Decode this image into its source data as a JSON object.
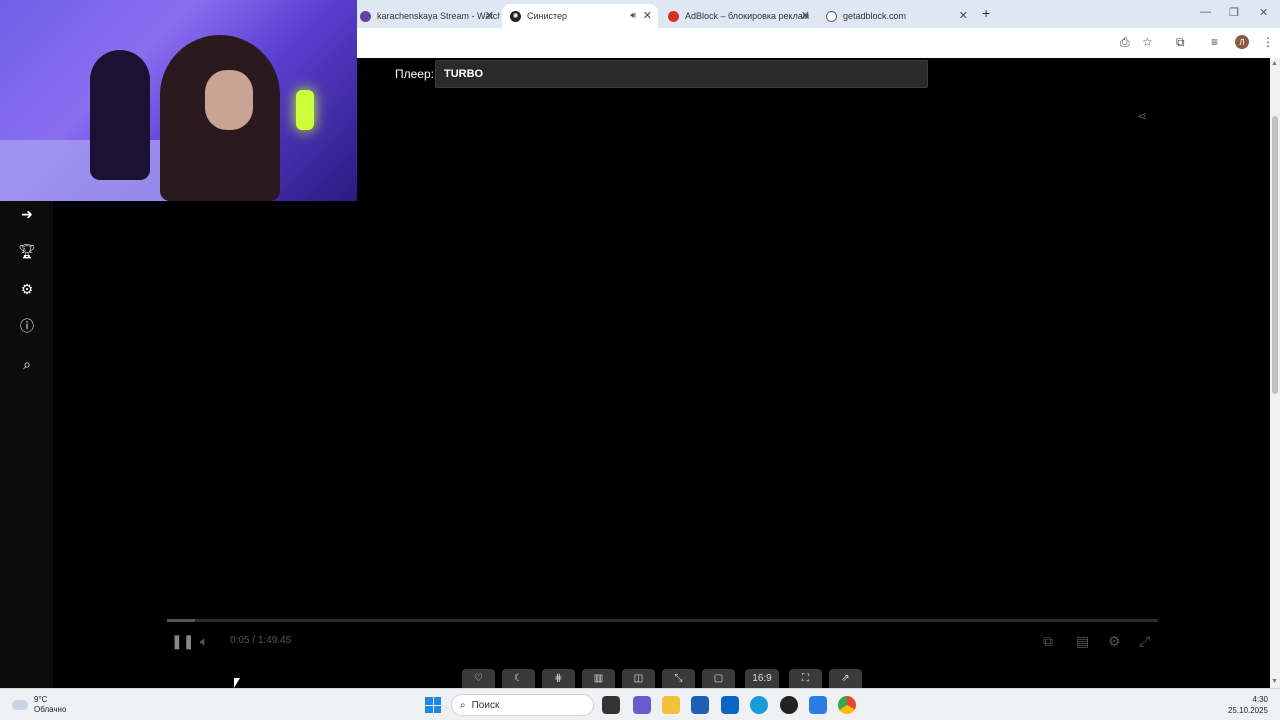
{
  "browser": {
    "tabs": [
      {
        "title": "karachenskaya Stream - Watch",
        "active": false
      },
      {
        "title": "Синистер",
        "active": true
      },
      {
        "title": "AdBlock – блокировка реклам",
        "active": false
      },
      {
        "title": "getadblock.com",
        "active": false
      }
    ],
    "new_tab_symbol": "+",
    "profile_initial": "Л"
  },
  "player": {
    "label": "Плеер:",
    "selected": "TURBO",
    "time_current": "0:05",
    "time_separator": "/",
    "time_total": "1:49:45",
    "progress_fraction": 0.028
  },
  "bottom_buttons": [
    {
      "name": "favorite-button",
      "label": "♡"
    },
    {
      "name": "night-mode-button",
      "label": "☾"
    },
    {
      "name": "grid-button",
      "label": "⋕"
    },
    {
      "name": "equalizer-button",
      "label": "▥"
    },
    {
      "name": "split-button",
      "label": "◫"
    },
    {
      "name": "resize-button",
      "label": "⤡"
    },
    {
      "name": "window-button",
      "label": "▢"
    },
    {
      "name": "aspect-ratio-button",
      "label": "16:9"
    },
    {
      "name": "screenshot-button",
      "label": "⛶"
    },
    {
      "name": "external-button",
      "label": "⇗"
    }
  ],
  "taskbar": {
    "weather_temp": "9°C",
    "weather_desc": "Облачно",
    "search_placeholder": "Поиск",
    "time": "4:30",
    "date": "25.10.2025"
  }
}
